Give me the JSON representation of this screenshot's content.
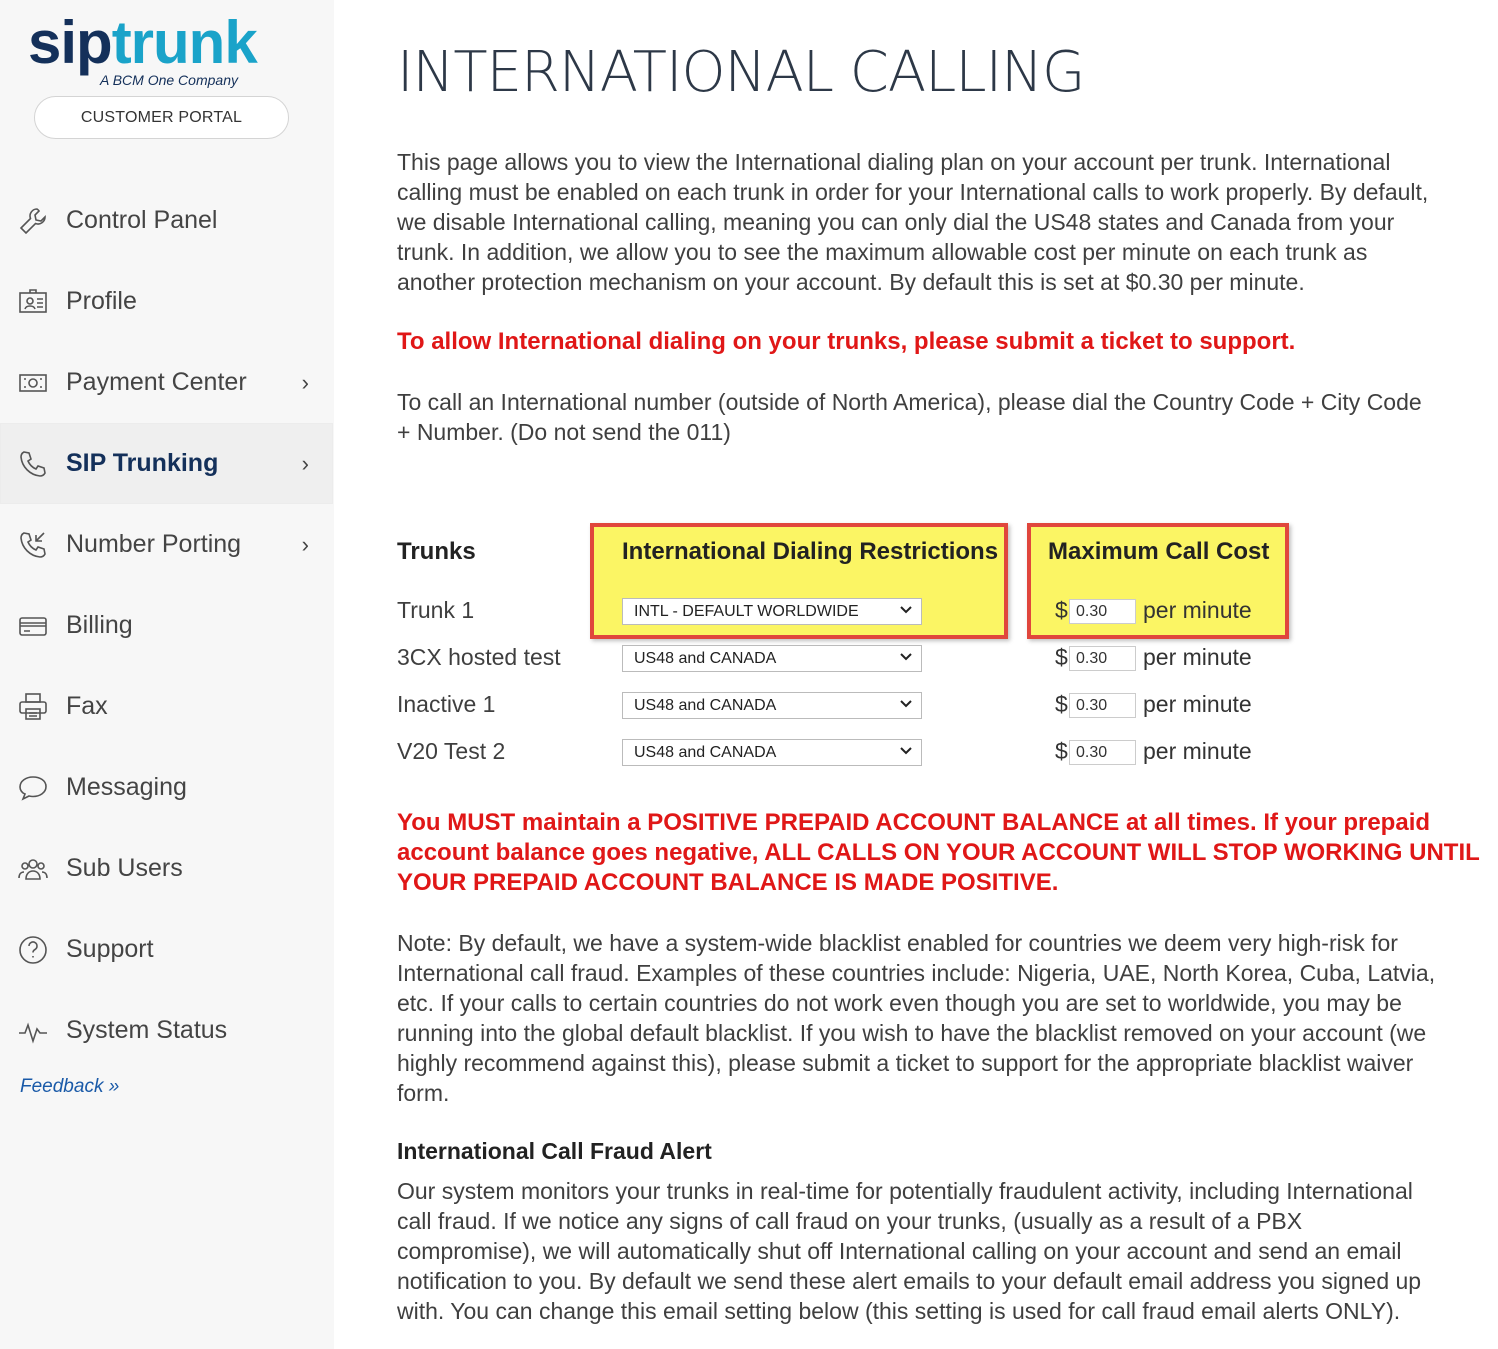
{
  "brand": {
    "logo_sip": "sip",
    "logo_trunk": "trunk",
    "logo_tagline": "A BCM One Company",
    "portal_button": "CUSTOMER PORTAL"
  },
  "sidebar": {
    "items": [
      {
        "label": "Control Panel",
        "icon": "wrench-icon",
        "has_chevron": false
      },
      {
        "label": "Profile",
        "icon": "id-card-icon",
        "has_chevron": false
      },
      {
        "label": "Payment Center",
        "icon": "money-icon",
        "has_chevron": true
      },
      {
        "label": "SIP Trunking",
        "icon": "phone-icon",
        "has_chevron": true,
        "active": true
      },
      {
        "label": "Number Porting",
        "icon": "phone-incoming-icon",
        "has_chevron": true
      },
      {
        "label": "Billing",
        "icon": "credit-card-icon",
        "has_chevron": false
      },
      {
        "label": "Fax",
        "icon": "printer-icon",
        "has_chevron": false
      },
      {
        "label": "Messaging",
        "icon": "chat-bubble-icon",
        "has_chevron": false
      },
      {
        "label": "Sub Users",
        "icon": "users-icon",
        "has_chevron": false
      },
      {
        "label": "Support",
        "icon": "question-circle-icon",
        "has_chevron": false
      },
      {
        "label": "System Status",
        "icon": "pulse-icon",
        "has_chevron": false
      }
    ],
    "chevron": "›",
    "feedback": "Feedback »"
  },
  "main": {
    "title": "INTERNATIONAL CALLING",
    "intro": "This page allows you to view the International dialing plan on your account per trunk. International calling must be enabled on each trunk in order for your International calls to work properly. By default, we disable International calling, meaning you can only dial the US48 states and Canada from your trunk. In addition, we allow you to see the maximum allowable cost per minute on each trunk as another protection mechanism on your account. By default this is set at $0.30 per minute.",
    "allow_notice": "To allow International dialing on your trunks, please submit a ticket to support.",
    "dial_instructions": "To call an International number (outside of North America), please dial the Country Code + City Code + Number. (Do not send the 011)",
    "table": {
      "col_trunks": "Trunks",
      "col_restrictions": "International Dialing Restrictions",
      "col_cost": "Maximum Call Cost",
      "currency": "$",
      "unit": "per minute",
      "rows": [
        {
          "name": "Trunk 1",
          "restriction": "INTL - DEFAULT WORLDWIDE",
          "cost": "0.30"
        },
        {
          "name": "3CX hosted test",
          "restriction": "US48 and CANADA",
          "cost": "0.30"
        },
        {
          "name": "Inactive 1",
          "restriction": "US48 and CANADA",
          "cost": "0.30"
        },
        {
          "name": "V20 Test 2",
          "restriction": "US48 and CANADA",
          "cost": "0.30"
        }
      ]
    },
    "balance_warning_l1": "You MUST maintain a POSITIVE PREPAID ACCOUNT BALANCE at all times. If your prepaid",
    "balance_warning_l2": "account balance goes negative, ALL CALLS ON YOUR ACCOUNT WILL STOP WORKING UNTIL",
    "balance_warning_l3": "YOUR PREPAID ACCOUNT BALANCE IS MADE POSITIVE.",
    "blacklist_note": "Note: By default, we have a system-wide blacklist enabled for countries we deem very high-risk for International call fraud. Examples of these countries include: Nigeria, UAE, North Korea, Cuba, Latvia, etc. If your calls to certain countries do not work even though you are set to worldwide, you may be running into the global default blacklist. If you wish to have the blacklist removed on your account (we highly recommend against this), please submit a ticket to support for the appropriate blacklist waiver form.",
    "fraud_heading": "International Call Fraud Alert",
    "fraud_text": "Our system monitors your trunks in real-time for potentially fraudulent activity, including International call fraud. If we notice any signs of call fraud on your trunks, (usually as a result of a PBX compromise), we will automatically shut off International calling on your account and send an email notification to you. By default we send these alert emails to your default email address you signed up with. You can change this email setting below (this setting is used for call fraud email alerts ONLY)."
  },
  "colors": {
    "accent_red": "#e01717",
    "highlight_yellow": "#fbf564",
    "highlight_border": "#e0463c",
    "brand_navy": "#14305a",
    "brand_cyan": "#1aa3c9"
  }
}
